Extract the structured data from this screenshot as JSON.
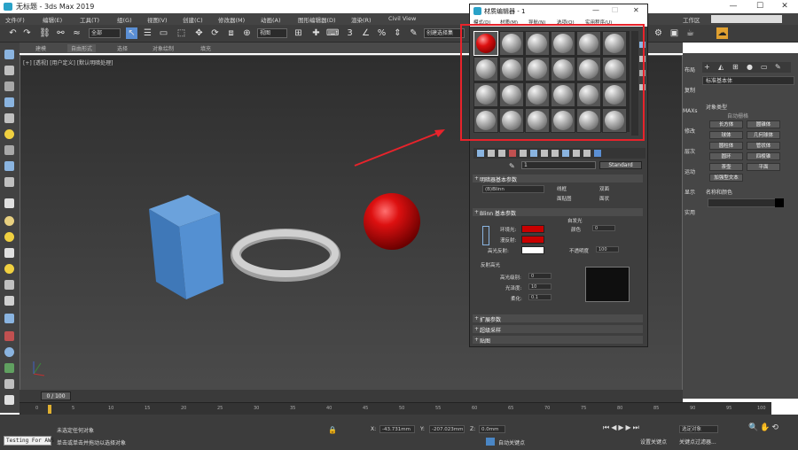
{
  "window": {
    "title": "无标题 - 3ds Max 2019",
    "controls": [
      "—",
      "☐",
      "✕"
    ]
  },
  "menu": {
    "items": [
      "文件(F)",
      "编辑(E)",
      "工具(T)",
      "组(G)",
      "视图(V)",
      "创建(C)",
      "修改器(M)",
      "动画(A)",
      "图形编辑器(D)",
      "渲染(R)",
      "Civil View"
    ],
    "workspace_label": "工作区"
  },
  "toolbar": {
    "selection_filter": "全部",
    "view_dropdown": "视图",
    "selection_set": "创建选择集"
  },
  "ribbon": {
    "tabs": [
      "建模",
      "自由形式",
      "选择",
      "对象绘制",
      "填充"
    ]
  },
  "viewport": {
    "label": "[+] [透视] [用户定义] [默认明暗处理]",
    "frame_counter": "0 / 100"
  },
  "material_editor": {
    "title": "材质编辑器 - 1",
    "menu": [
      "模式(D)",
      "材质(M)",
      "导航(N)",
      "选项(O)",
      "实用程序(U)"
    ],
    "material_name": "1",
    "material_type": "Standard",
    "shader_rollout": "明暗器基本参数",
    "shader_type": "(B)Blinn",
    "options": [
      "线框",
      "双面",
      "面贴图",
      "面状"
    ],
    "blinn_rollout": "Blinn 基本参数",
    "self_illum_label": "自发光",
    "color_label": "颜色",
    "color_value": "0",
    "ambient_label": "环境光:",
    "diffuse_label": "漫反射:",
    "specular_label": "高光反射:",
    "opacity_label": "不透明度",
    "opacity_value": "100",
    "spec_highlights": "反射高光",
    "spec_level_label": "高光级别:",
    "spec_level_value": "0",
    "gloss_label": "光泽度:",
    "gloss_value": "10",
    "soften_label": "柔化:",
    "soften_value": "0.1",
    "rollouts": [
      "扩展参数",
      "超级采样",
      "贴图"
    ],
    "colors": {
      "ambient": "#c80000",
      "diffuse": "#c80000",
      "specular": "#ffffff"
    }
  },
  "command_panel": {
    "tabs": [
      "布局",
      "复制",
      "MAXs",
      "修改",
      "层次",
      "运动",
      "显示",
      "实用"
    ],
    "category": "标准基本体",
    "object_type_header": "对象类型",
    "autogrid": "自动栅格",
    "buttons": [
      "长方体",
      "圆锥体",
      "球体",
      "几何球体",
      "圆柱体",
      "管状体",
      "圆环",
      "四棱锥",
      "茶壶",
      "平面",
      "加强型文本"
    ],
    "name_color_header": "名称和颜色"
  },
  "status": {
    "script_label": "Testing For AWS",
    "status_line1": "未选定任何对象",
    "status_line2": "单击或单击并拖动以选择对象",
    "x_label": "X:",
    "x_value": "-43.731mm",
    "y_label": "Y:",
    "y_value": "-207.023mm",
    "z_label": "Z:",
    "z_value": "0.0mm",
    "autokey": "自动关键点",
    "selected": "选定对象",
    "setkey": "设置关键点",
    "keyfilters": "关键点过滤器..."
  },
  "timeline": {
    "ticks": [
      "0",
      "5",
      "10",
      "15",
      "20",
      "25",
      "30",
      "35",
      "40",
      "45",
      "50",
      "55",
      "60",
      "65",
      "70",
      "75",
      "80",
      "85",
      "90",
      "95",
      "100"
    ]
  },
  "colors": {
    "accent_red": "#e8232b",
    "viewport_bg": "#3a3a3a",
    "cube": "#4a86c5",
    "torus": "#c8c8c8",
    "sphere": "#d41010"
  }
}
